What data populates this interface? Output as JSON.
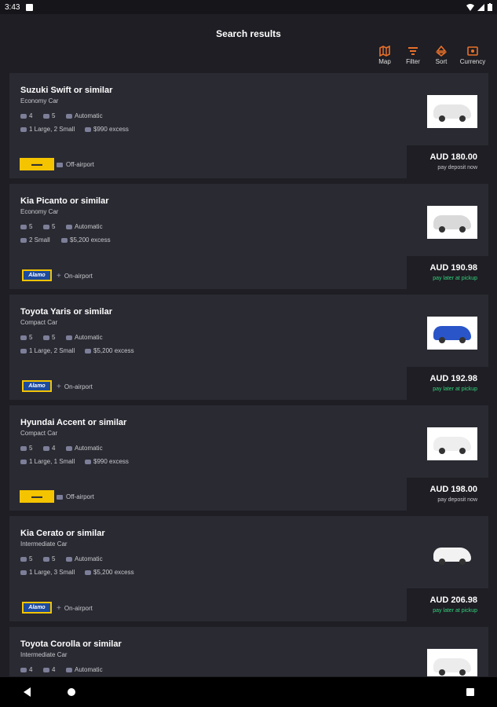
{
  "status": {
    "time": "3:43"
  },
  "header": {
    "title": "Search results"
  },
  "toolbar": [
    {
      "label": "Map",
      "icon": "map-icon"
    },
    {
      "label": "Filter",
      "icon": "filter-icon"
    },
    {
      "label": "Sort",
      "icon": "sort-icon"
    },
    {
      "label": "Currency",
      "icon": "currency-icon"
    }
  ],
  "colors": {
    "accent": "#e8702a",
    "green": "#33d27a",
    "card": "#2a2a33",
    "bg": "#1e1e24"
  },
  "cars": [
    {
      "name": "Suzuki Swift or similar",
      "class": "Economy Car",
      "seats": "4",
      "doors": "5",
      "transmission": "Automatic",
      "luggage": "1 Large, 2 Small",
      "excess": "$990 excess",
      "supplier": "yellow",
      "location": "Off-airport",
      "price": "AUD 180.00",
      "note": "pay deposit now",
      "note_green": false,
      "car_color": "#e6e6e6"
    },
    {
      "name": "Kia Picanto or similar",
      "class": "Economy Car",
      "seats": "5",
      "doors": "5",
      "transmission": "Automatic",
      "luggage": "2 Small",
      "excess": "$5,200 excess",
      "supplier": "alamo",
      "supplier_label": "Alamo",
      "location": "On-airport",
      "price": "AUD 190.98",
      "note": "pay later at pickup",
      "note_green": true,
      "car_color": "#d9d9d9"
    },
    {
      "name": "Toyota Yaris or similar",
      "class": "Compact Car",
      "seats": "5",
      "doors": "5",
      "transmission": "Automatic",
      "luggage": "1 Large, 2 Small",
      "excess": "$5,200 excess",
      "supplier": "alamo",
      "supplier_label": "Alamo",
      "location": "On-airport",
      "price": "AUD 192.98",
      "note": "pay later at pickup",
      "note_green": true,
      "car_color": "#2a55c9"
    },
    {
      "name": "Hyundai Accent or similar",
      "class": "Compact Car",
      "seats": "5",
      "doors": "4",
      "transmission": "Automatic",
      "luggage": "1 Large, 1 Small",
      "excess": "$990 excess",
      "supplier": "yellow",
      "location": "Off-airport",
      "price": "AUD 198.00",
      "note": "pay deposit now",
      "note_green": false,
      "car_color": "#eeeeee"
    },
    {
      "name": "Kia Cerato or similar",
      "class": "Intermediate Car",
      "seats": "5",
      "doors": "5",
      "transmission": "Automatic",
      "luggage": "1 Large, 3 Small",
      "excess": "$5,200 excess",
      "supplier": "alamo",
      "supplier_label": "Alamo",
      "location": "On-airport",
      "price": "AUD 206.98",
      "note": "pay later at pickup",
      "note_green": true,
      "car_color": "#f2f2f2",
      "noframe": true
    },
    {
      "name": "Toyota Corolla or similar",
      "class": "Intermediate Car",
      "seats": "4",
      "doors": "4",
      "transmission": "Automatic",
      "car_color": "#ececec"
    }
  ]
}
